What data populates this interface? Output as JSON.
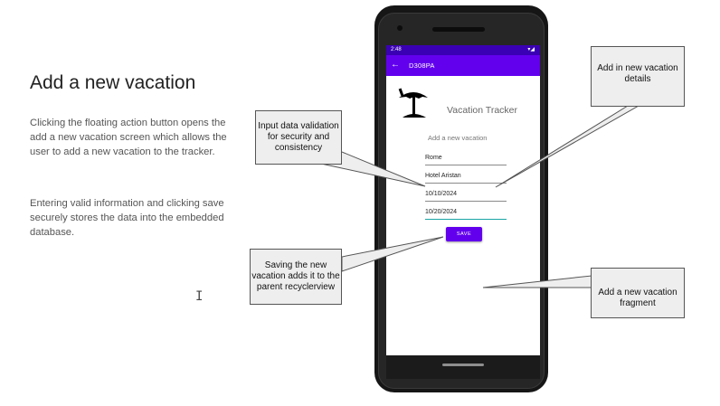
{
  "slide": {
    "title": "Add a new vacation",
    "paragraph1": "Clicking the floating action button opens the add a new vacation screen which allows the user to add a new vacation to the tracker.",
    "paragraph2": "Entering valid information and clicking save securely stores the data into the embedded database.",
    "cursor_glyph": "I"
  },
  "phone": {
    "status_time": "2:48",
    "status_icons": "▾◢",
    "app_title": "D308PA",
    "back_glyph": "←",
    "tracker_title": "Vacation Tracker",
    "subtitle": "Add a new vacation",
    "fields": [
      "Rome",
      "Hotel Aristan",
      "10/10/2024",
      "10/20/2024"
    ],
    "save_label": "SAVE",
    "icon": "beach-umbrella-icon"
  },
  "callouts": {
    "validation": "Input data validation for security and consistency",
    "details": "Add in new vacation details",
    "saving": "Saving the new vacation adds it to the parent recyclerview",
    "fragment": "Add a new vacation fragment"
  },
  "colors": {
    "appbar": "#6200ee",
    "statusbar": "#3a00b3",
    "focus_underline": "#1aa4a4"
  }
}
